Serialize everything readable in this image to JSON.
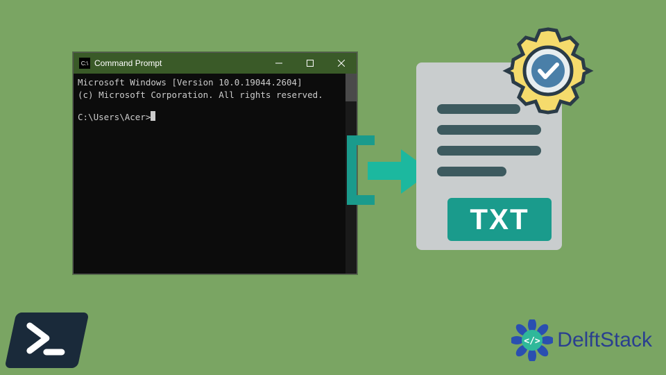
{
  "cmd": {
    "title": "Command Prompt",
    "line1": "Microsoft Windows [Version 10.0.19044.2604]",
    "line2": "(c) Microsoft Corporation. All rights reserved.",
    "prompt": "C:\\Users\\Acer>"
  },
  "txt_label": "TXT",
  "brand": "DelftStack"
}
